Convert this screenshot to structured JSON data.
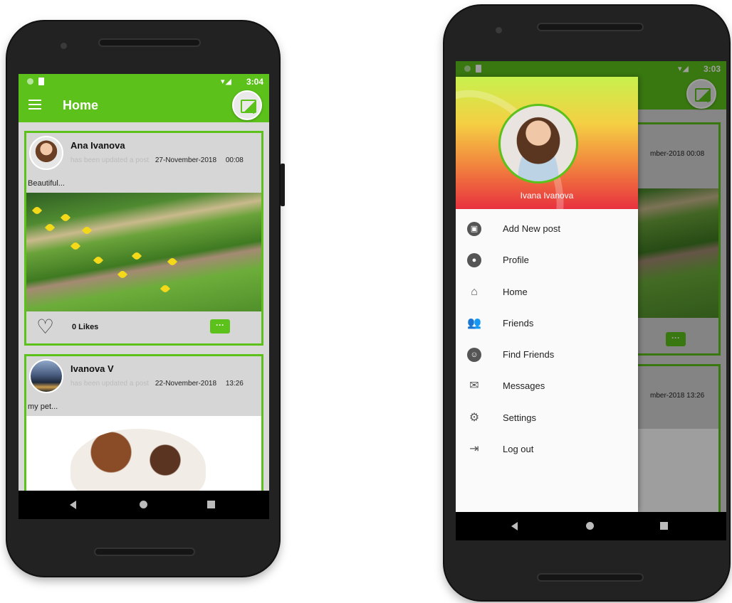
{
  "left_phone": {
    "status": {
      "time": "3:04",
      "signal": "▾◢"
    },
    "appbar": {
      "title": "Home"
    },
    "posts": [
      {
        "user": "Ana Ivanova",
        "action": "has been updated a post",
        "date": "27-November-2018",
        "time": "00:08",
        "description": "Beautiful...",
        "likes": "0 Likes",
        "comment_icon": "···"
      },
      {
        "user": "Ivanova V",
        "action": "has been updated a post",
        "date": "22-November-2018",
        "time": "13:26",
        "description": "my pet..."
      }
    ]
  },
  "right_phone": {
    "status": {
      "time": "3:03",
      "signal": "▾◢"
    },
    "behind": {
      "post1_meta": "mber-2018  00:08",
      "post2_meta": "mber-2018  13:26",
      "comment_icon": "···"
    },
    "drawer": {
      "profile_name": "Ivana Ivanova",
      "items": [
        {
          "label": "Add New post",
          "icon": "image-add-icon"
        },
        {
          "label": "Profile",
          "icon": "profile-icon"
        },
        {
          "label": "Home",
          "icon": "home-icon"
        },
        {
          "label": "Friends",
          "icon": "friends-icon"
        },
        {
          "label": "Find Friends",
          "icon": "find-friends-icon"
        },
        {
          "label": "Messages",
          "icon": "envelope-icon"
        },
        {
          "label": "Settings",
          "icon": "gears-icon"
        },
        {
          "label": "Log out",
          "icon": "logout-icon"
        }
      ]
    }
  },
  "colors": {
    "accent": "#5cc11a",
    "navbar": "#000000",
    "card_bg": "#d6d6d6"
  }
}
